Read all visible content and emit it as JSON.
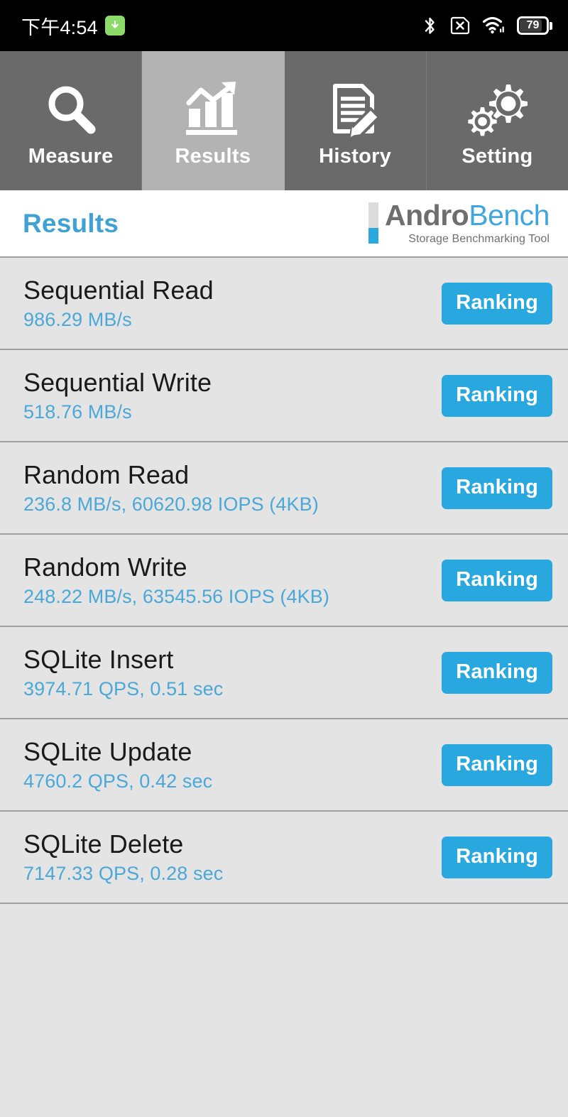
{
  "status_bar": {
    "time": "下午4:54",
    "download_icon": "download-arrow-icon",
    "bluetooth_icon": "bluetooth-icon",
    "sim_icon": "no-sim-card-icon",
    "wifi_icon": "wifi-icon",
    "battery_level": "79",
    "colors": {
      "background": "#000000",
      "download_badge": "#8ddb6a"
    }
  },
  "tabs": [
    {
      "label": "Measure",
      "icon": "magnifier-icon",
      "active": false
    },
    {
      "label": "Results",
      "icon": "bar-chart-arrow-icon",
      "active": true
    },
    {
      "label": "History",
      "icon": "document-pencil-icon",
      "active": false
    },
    {
      "label": "Setting",
      "icon": "gears-icon",
      "active": false
    }
  ],
  "header": {
    "title": "Results",
    "brand_first": "Andro",
    "brand_second": "Bench",
    "tagline": "Storage Benchmarking Tool"
  },
  "results": {
    "ranking_label": "Ranking",
    "rows": [
      {
        "name": "Sequential Read",
        "value": "986.29 MB/s"
      },
      {
        "name": "Sequential Write",
        "value": "518.76 MB/s"
      },
      {
        "name": "Random Read",
        "value": "236.8 MB/s, 60620.98 IOPS (4KB)"
      },
      {
        "name": "Random Write",
        "value": "248.22 MB/s, 63545.56 IOPS (4KB)"
      },
      {
        "name": "SQLite Insert",
        "value": "3974.71 QPS, 0.51 sec"
      },
      {
        "name": "SQLite Update",
        "value": "4760.2 QPS, 0.42 sec"
      },
      {
        "name": "SQLite Delete",
        "value": "7147.33 QPS, 0.28 sec"
      }
    ]
  },
  "colors": {
    "accent_blue": "#29a8e0",
    "value_blue": "#4aa8d8",
    "title_blue": "#3fa2d4",
    "tab_inactive": "#6a6a6a",
    "tab_active": "#b3b3b3",
    "row_background": "#e4e4e4",
    "divider": "#9e9e9e"
  }
}
